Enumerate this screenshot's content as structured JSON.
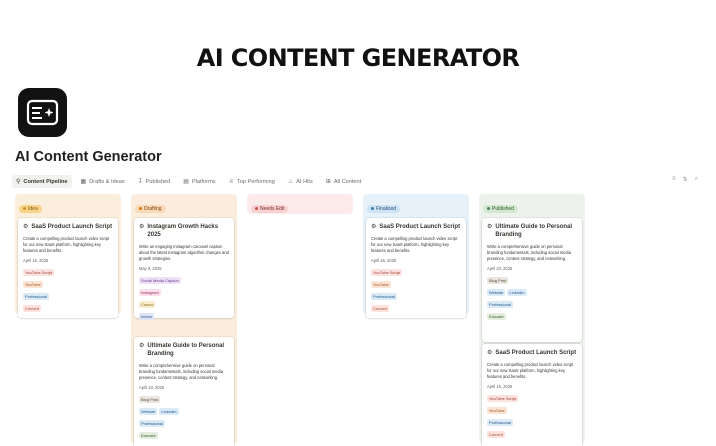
{
  "banner": {
    "title": "AI CONTENT GENERATOR"
  },
  "page": {
    "title": "AI Content Generator",
    "icon": "ai-sparkle-icon"
  },
  "tabs": [
    {
      "label": "Content Pipeline",
      "icon": "pipeline-icon"
    },
    {
      "label": "Drafts & Ideas",
      "icon": "table-icon"
    },
    {
      "label": "Published",
      "icon": "pin-icon"
    },
    {
      "label": "Platforms",
      "icon": "table-icon"
    },
    {
      "label": "Top Performing",
      "icon": "trophy-icon"
    },
    {
      "label": "AI Hits",
      "icon": "flame-icon"
    },
    {
      "label": "All Content",
      "icon": "grid-icon"
    }
  ],
  "toolbar": {
    "icons": [
      "filter-icon",
      "sort-icon",
      "search-icon"
    ]
  },
  "colors": {
    "idea": "#fbeedd",
    "drafting": "#fbecdd",
    "needs_edit": "#fdebec",
    "finalized": "#e7f1fa",
    "published": "#edf3ec"
  },
  "columns": [
    {
      "status": "Idea",
      "cards": [
        {
          "title": "SaaS Product Launch Script",
          "description": "Create a compelling product launch video script for our new SaaS platform, highlighting key features and benefits.",
          "date": "April 16, 2025",
          "tags": [
            [
              "YouTube Script"
            ],
            [
              "YouTube"
            ],
            [
              "Professional"
            ],
            [
              "Convert"
            ]
          ]
        }
      ]
    },
    {
      "status": "Drafting",
      "cards": [
        {
          "title": "Instagram Growth Hacks 2025",
          "description": "Write an engaging Instagram carousel caption about the latest Instagram algorithm changes and growth strategies.",
          "date": "May 8, 2025",
          "tags": [
            [
              "Social Media Caption"
            ],
            [
              "Instagram"
            ],
            [
              "Casual"
            ],
            [
              "Inform"
            ]
          ]
        },
        {
          "title": "Ultimate Guide to Personal Branding",
          "description": "Write a comprehensive guide on personal branding fundamentals, including social media presence, content strategy, and networking.",
          "date": "April 23, 2025",
          "tags": [
            [
              "Blog Post"
            ],
            [
              "Website",
              "LinkedIn"
            ],
            [
              "Professional"
            ],
            [
              "Educate"
            ]
          ]
        }
      ]
    },
    {
      "status": "Needs Edit",
      "cards": []
    },
    {
      "status": "Finalized",
      "cards": [
        {
          "title": "SaaS Product Launch Script",
          "description": "Create a compelling product launch video script for our new SaaS platform, highlighting key features and benefits.",
          "date": "April 16, 2025",
          "tags": [
            [
              "YouTube Script"
            ],
            [
              "YouTube"
            ],
            [
              "Professional"
            ],
            [
              "Convert"
            ]
          ]
        }
      ]
    },
    {
      "status": "Published",
      "cards": [
        {
          "title": "Ultimate Guide to Personal Branding",
          "description": "Write a comprehensive guide on personal branding fundamentals, including social media presence, content strategy, and networking.",
          "date": "April 23, 2025",
          "tags": [
            [
              "Blog Post"
            ],
            [
              "Website",
              "LinkedIn"
            ],
            [
              "Professional"
            ],
            [
              "Educate"
            ]
          ]
        },
        {
          "title": "SaaS Product Launch Script",
          "description": "Create a compelling product launch video script for our new SaaS platform, highlighting key features and benefits.",
          "date": "April 16, 2025",
          "tags": [
            [
              "YouTube Script"
            ],
            [
              "YouTube"
            ],
            [
              "Professional"
            ],
            [
              "Convert"
            ]
          ]
        }
      ]
    }
  ]
}
